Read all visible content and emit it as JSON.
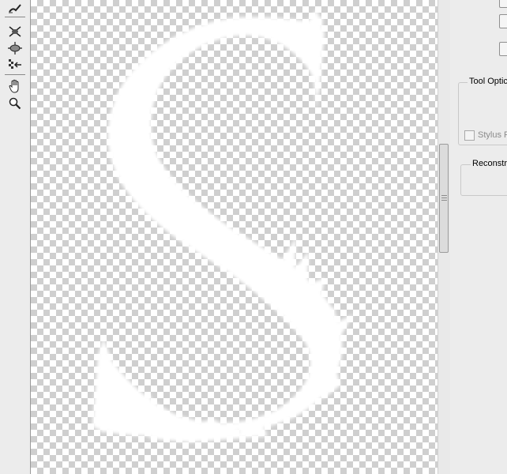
{
  "toolbar": {
    "tools": [
      {
        "name": "forward-warp-tool",
        "icon": "brush-icon"
      },
      {
        "name": "pucker-tool",
        "icon": "pucker-icon"
      },
      {
        "name": "bloat-tool",
        "icon": "bloat-icon"
      },
      {
        "name": "push-left-tool",
        "icon": "push-left-icon"
      },
      {
        "name": "hand-tool",
        "icon": "hand-icon"
      },
      {
        "name": "zoom-tool",
        "icon": "magnifier-icon"
      }
    ]
  },
  "canvas": {
    "background": "transparency-checkerboard",
    "artwork": "S",
    "artwork_color": "#ffffff"
  },
  "panel": {
    "tool_options_title": "Tool Optic",
    "stylus_label": "Stylus F",
    "reconstruct_title": "Reconstr"
  }
}
